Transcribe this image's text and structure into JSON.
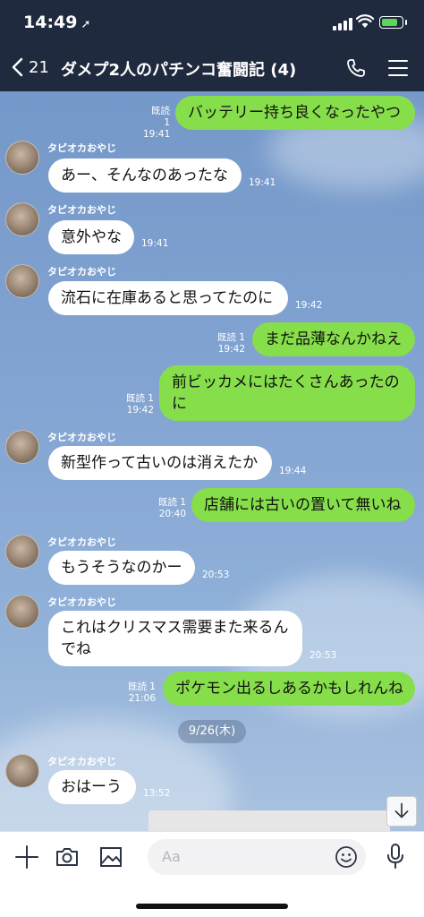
{
  "status": {
    "time": "14:49",
    "location_arrow": "➚"
  },
  "header": {
    "back_count": "21",
    "title": "ダメプ2人のパチンコ奮闘記 (4)"
  },
  "messages": [
    {
      "dir": "out",
      "text": "バッテリー持ち良くなったやつ",
      "read": "既読 1",
      "time": "19:41"
    },
    {
      "dir": "in",
      "sender": "タピオカおやじ",
      "text": "あー、そんなのあったな",
      "time": "19:41"
    },
    {
      "dir": "in",
      "sender": "タピオカおやじ",
      "text": "意外やな",
      "time": "19:41"
    },
    {
      "dir": "in",
      "sender": "タピオカおやじ",
      "text": "流石に在庫あると思ってたのに",
      "time": "19:42"
    },
    {
      "dir": "out",
      "text": "まだ品薄なんかねえ",
      "read": "既読 1",
      "time": "19:42"
    },
    {
      "dir": "out",
      "text": "前ビッカメにはたくさんあったのに",
      "read": "既読 1",
      "time": "19:42"
    },
    {
      "dir": "in",
      "sender": "タピオカおやじ",
      "text": "新型作って古いのは消えたか",
      "time": "19:44"
    },
    {
      "dir": "out",
      "text": "店舗には古いの置いて無いね",
      "read": "既読 1",
      "time": "20:40"
    },
    {
      "dir": "in",
      "sender": "タピオカおやじ",
      "text": "もうそうなのかー",
      "time": "20:53"
    },
    {
      "dir": "in",
      "sender": "タピオカおやじ",
      "text": "これはクリスマス需要また来るんでね",
      "time": "20:53"
    },
    {
      "dir": "out",
      "text": "ポケモン出るしあるかもしれんね",
      "read": "既読 1",
      "time": "21:06"
    },
    {
      "dir": "in",
      "sender": "タピオカおやじ",
      "text": "おはーう",
      "time": "13:52"
    }
  ],
  "date_separator": "9/26(木)",
  "input": {
    "placeholder": "Aa"
  },
  "colors": {
    "header_bg": "#1f2a3f",
    "out_bubble": "#86de4a",
    "in_bubble": "#ffffff",
    "battery": "#5ad65c"
  },
  "icons": [
    "back-icon",
    "call-icon",
    "menu-icon",
    "plus-icon",
    "camera-icon",
    "image-icon",
    "emoji-icon",
    "mic-icon",
    "arrow-down-icon"
  ]
}
